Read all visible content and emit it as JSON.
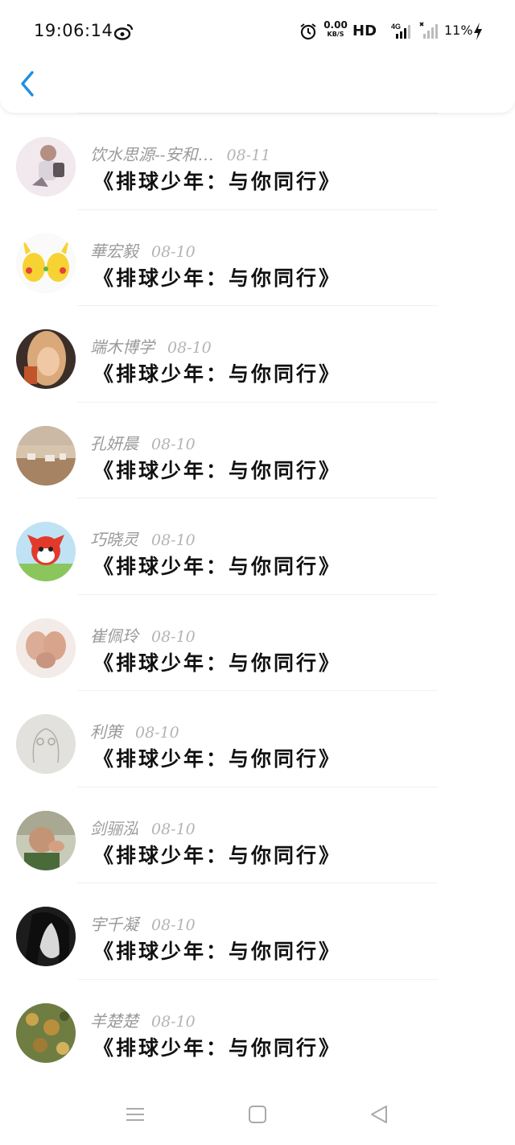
{
  "status_bar": {
    "time": "19:06:14",
    "net_speed_value": "0.00",
    "net_speed_unit": "KB/S",
    "hd_label": "HD",
    "signal_badge": "4G",
    "battery": "11%",
    "icons": [
      "weibo-icon",
      "alarm-icon",
      "signal-icon",
      "battery-charging-icon"
    ]
  },
  "header": {
    "back_icon": "chevron-left-icon",
    "accent": "#1e8fe1"
  },
  "list": {
    "items": [
      {
        "name": "饮水思源--安和…",
        "date": "08-11",
        "title": "《排球少年：与你同行》"
      },
      {
        "name": "華宏毅",
        "date": "08-10",
        "title": "《排球少年：与你同行》"
      },
      {
        "name": "端木博学",
        "date": "08-10",
        "title": "《排球少年：与你同行》"
      },
      {
        "name": "孔妍晨",
        "date": "08-10",
        "title": "《排球少年：与你同行》"
      },
      {
        "name": "巧晓灵",
        "date": "08-10",
        "title": "《排球少年：与你同行》"
      },
      {
        "name": "崔佩玲",
        "date": "08-10",
        "title": "《排球少年：与你同行》"
      },
      {
        "name": "利策",
        "date": "08-10",
        "title": "《排球少年：与你同行》"
      },
      {
        "name": "剑骊泓",
        "date": "08-10",
        "title": "《排球少年：与你同行》"
      },
      {
        "name": "宇千凝",
        "date": "08-10",
        "title": "《排球少年：与你同行》"
      },
      {
        "name": "羊楚楚",
        "date": "08-10",
        "title": "《排球少年：与你同行》"
      }
    ]
  },
  "navbar": {
    "icons": [
      "menu-icon",
      "home-square-icon",
      "back-triangle-icon"
    ]
  }
}
